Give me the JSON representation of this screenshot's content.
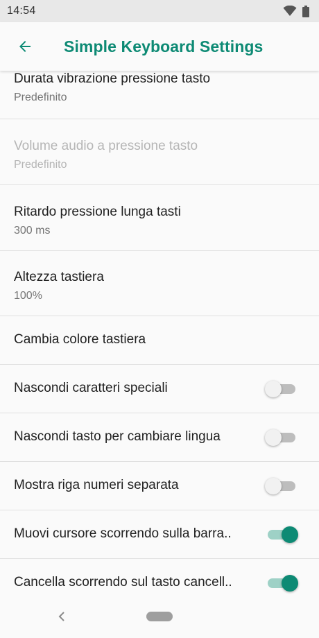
{
  "status": {
    "time": "14:54",
    "wifi_icon": "wifi-icon",
    "battery_icon": "battery-icon"
  },
  "app_bar": {
    "title": "Simple Keyboard Settings",
    "back_icon": "arrow-back-icon"
  },
  "settings": {
    "vibration": {
      "title": "Durata vibrazione pressione tasto",
      "value": "Predefinito"
    },
    "volume": {
      "title": "Volume audio a pressione tasto",
      "value": "Predefinito",
      "enabled": false
    },
    "long_press": {
      "title": "Ritardo pressione lunga tasti",
      "value": "300 ms"
    },
    "height": {
      "title": "Altezza tastiera",
      "value": "100%"
    },
    "color": {
      "title": "Cambia colore tastiera"
    },
    "hide_special": {
      "title": "Nascondi caratteri speciali",
      "checked": false
    },
    "hide_language": {
      "title": "Nascondi tasto per cambiare lingua",
      "checked": false
    },
    "number_row": {
      "title": "Mostra riga numeri separata",
      "checked": false
    },
    "cursor_swipe": {
      "title": "Muovi cursore scorrendo sulla barra..",
      "checked": true
    },
    "delete_swipe": {
      "title": "Cancella scorrendo sul tasto cancell..",
      "checked": true
    }
  },
  "nav": {
    "back_icon": "nav-back-icon",
    "home_icon": "home-pill-icon"
  },
  "colors": {
    "accent": "#0d8a74",
    "accent_track": "#9ed1c6",
    "divider": "#e0e0e0"
  }
}
